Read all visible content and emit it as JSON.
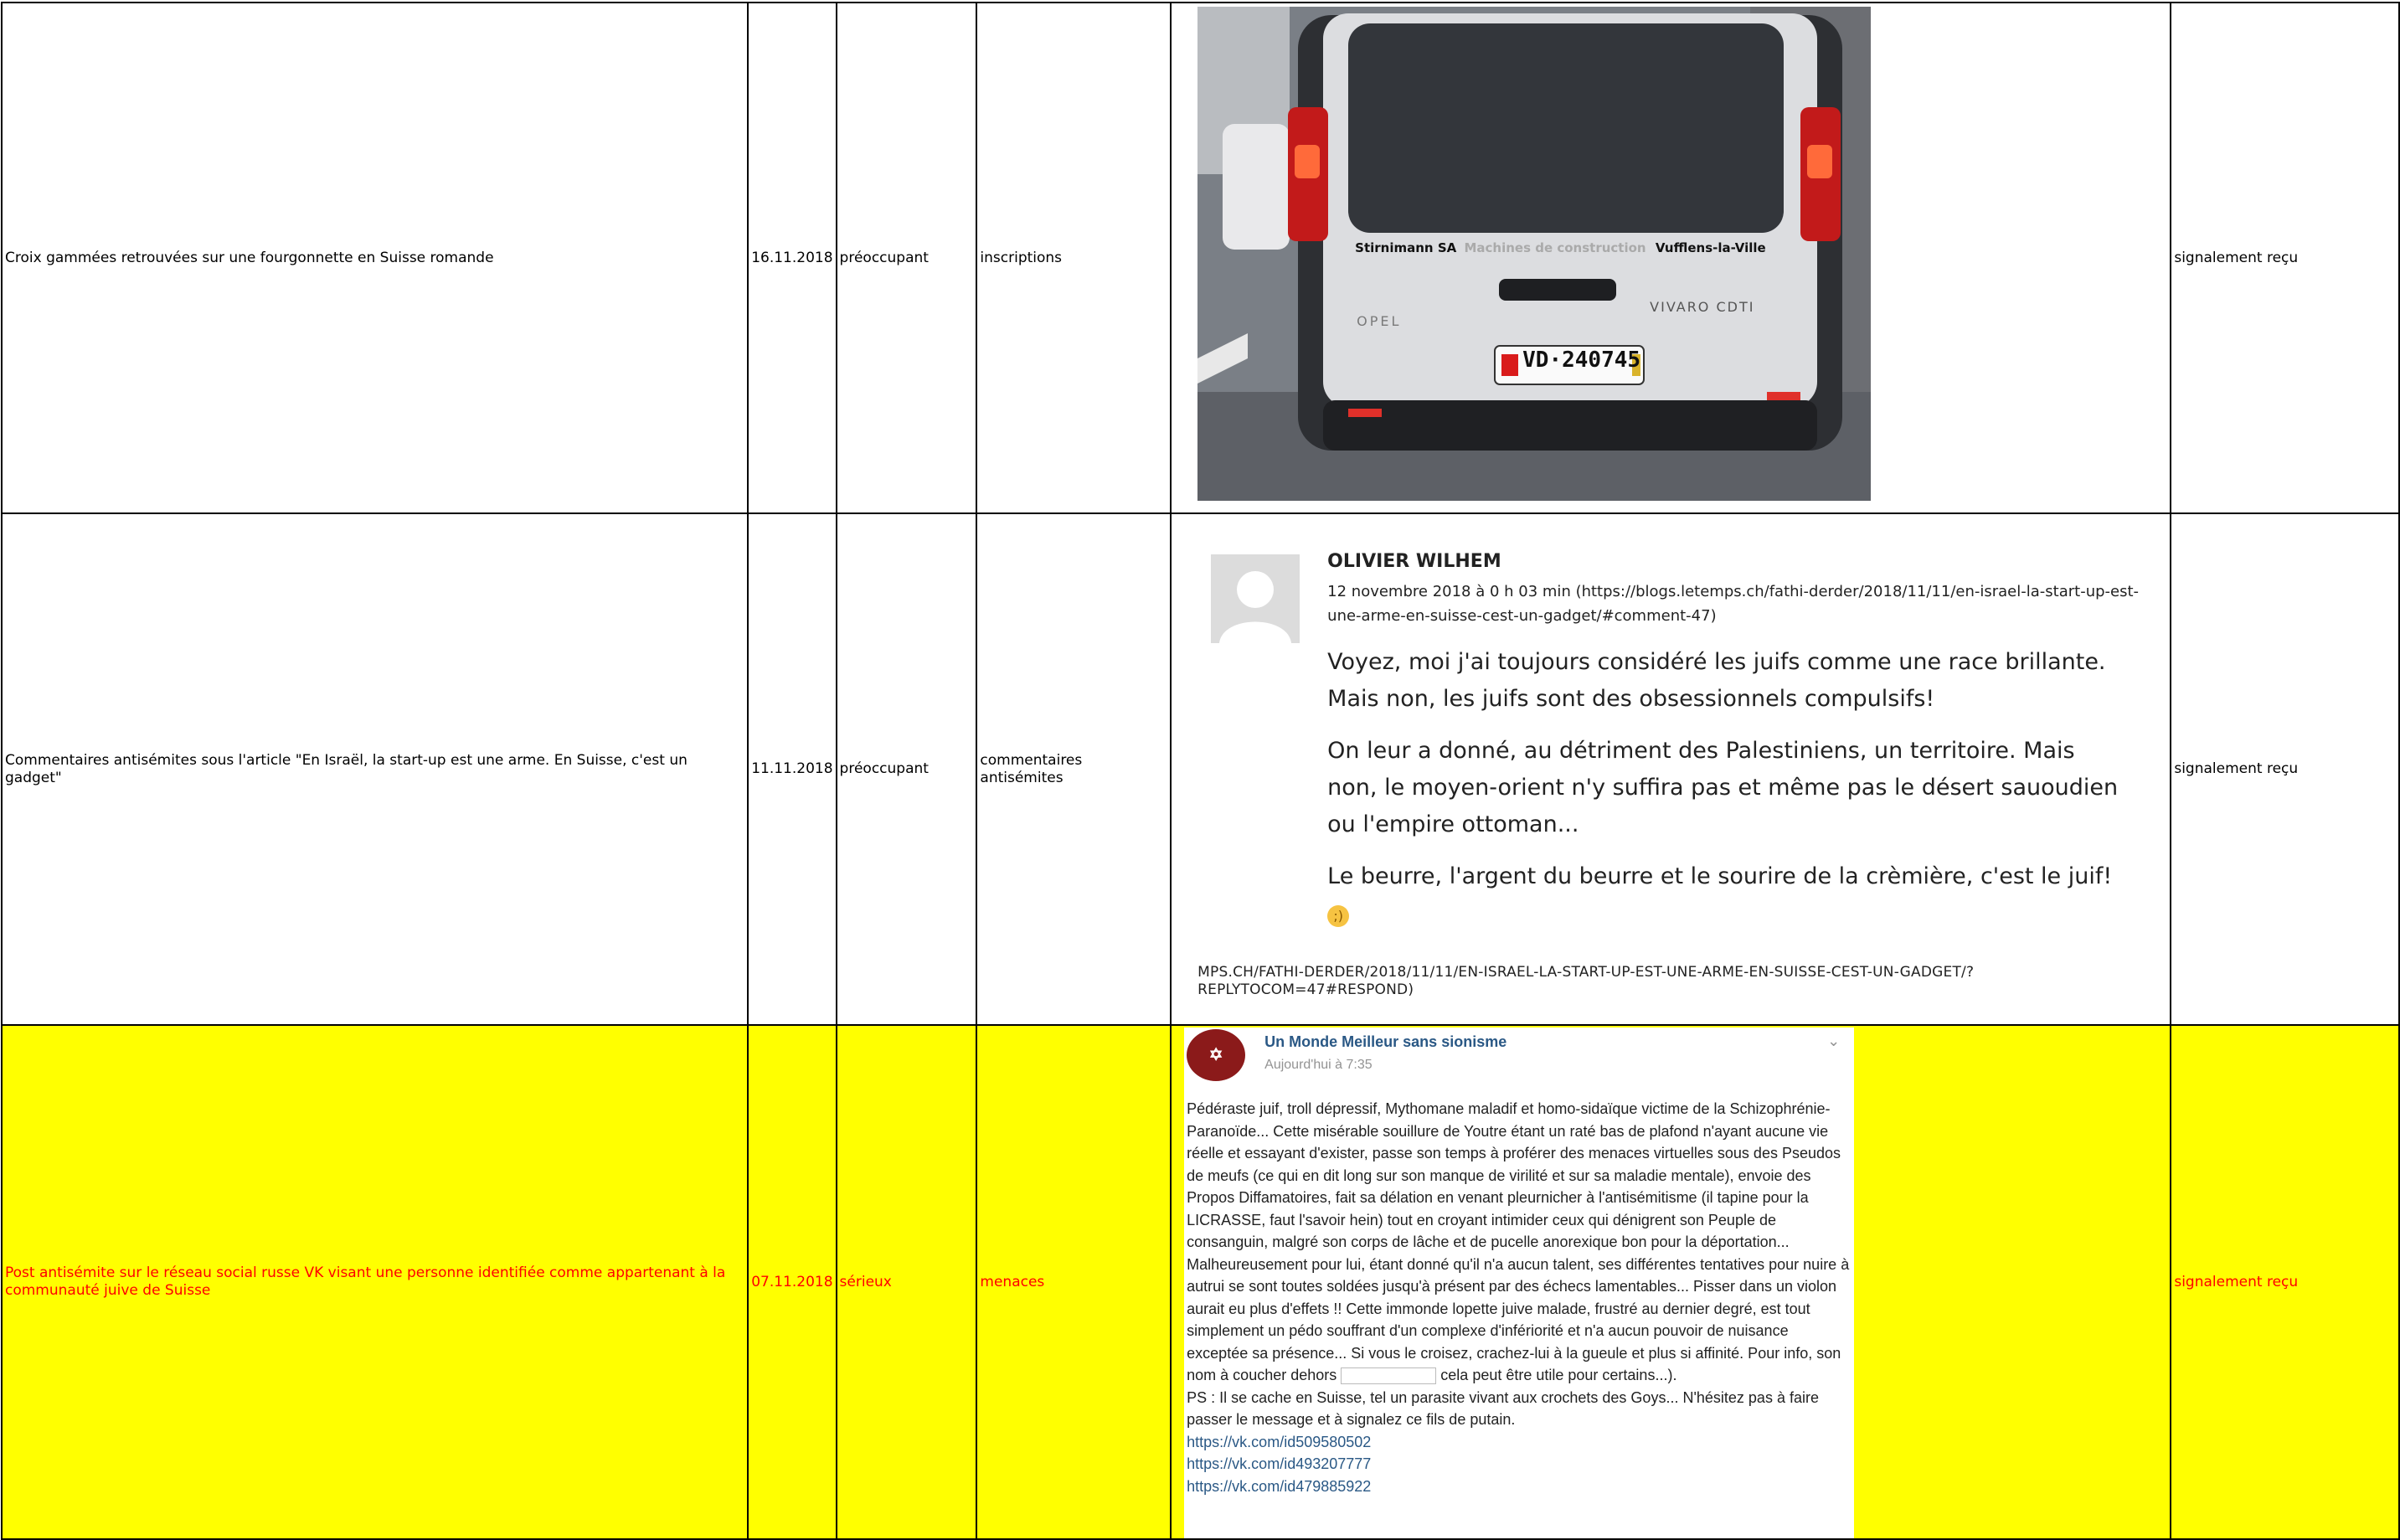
{
  "rows": [
    {
      "title": "Croix gammées retrouvées sur une fourgonnette en Suisse romande",
      "date": "16.11.2018",
      "severity": "préoccupant",
      "category": "inscriptions",
      "status": "signalement reçu",
      "image": {
        "company": "Stirnimann SA",
        "company_tail": "Machines de construction",
        "location": "Vufflens-la-Ville",
        "brand": "OPEL",
        "model": "VIVARO CDTI",
        "plate": "VD·240745"
      }
    },
    {
      "title": "Commentaires antisémites sous l'article \"En Israël, la start-up est une arme. En Suisse, c'est un gadget\"",
      "date": "11.11.2018",
      "severity": "préoccupant",
      "category": "commentaires antisémites",
      "status": "signalement reçu",
      "image": {
        "author": "OLIVIER WILHEM",
        "meta": "12 novembre 2018 à 0 h 03 min (https://blogs.letemps.ch/fathi-derder/2018/11/11/en-israel-la-start-up-est-une-arme-en-suisse-cest-un-gadget/#comment-47)",
        "p1": "Voyez, moi j'ai toujours considéré les juifs comme une race brillante.",
        "p1b": "Mais non, les juifs sont des obsessionnels compulsifs!",
        "p2": "On leur a donné, au détriment des Palestiniens, un territoire. Mais non, le moyen-orient n'y suffira pas et même pas le désert sauoudien ou l'empire ottoman...",
        "p3": "Le beurre, l'argent du beurre et le sourire de la crèmière, c'est le juif!",
        "reply_url": "MPS.CH/FATHI-DERDER/2018/11/11/EN-ISRAEL-LA-START-UP-EST-UNE-ARME-EN-SUISSE-CEST-UN-GADGET/?REPLYTOCOM=47#RESPOND)"
      }
    },
    {
      "title": "Post antisémite sur le réseau social russe VK visant une personne identifiée comme appartenant à la communauté juive de Suisse",
      "date": "07.11.2018",
      "severity": "sérieux",
      "category": "menaces",
      "status": "signalement reçu",
      "image": {
        "group": "Un Monde Meilleur sans sionisme",
        "time": "Aujourd'hui à 7:35",
        "text_a": "Pédéraste juif, troll dépressif, Mythomane maladif et homo-sidaïque victime de la Schizophrénie-Paranoïde... Cette misérable souillure de Youtre étant un raté bas de plafond n'ayant aucune vie réelle et essayant d'exister, passe son temps à proférer des menaces virtuelles sous des Pseudos de meufs (ce qui en dit long sur son manque de virilité et sur sa maladie mentale), envoie des Propos Diffamatoires, fait sa délation en venant pleurnicher à l'antisémitisme (il tapine pour la LICRASSE, faut l'savoir hein) tout en croyant intimider ceux qui dénigrent son Peuple de consanguin, malgré son corps de lâche et de pucelle anorexique bon pour la déportation... Malheureusement pour lui, étant donné qu'il n'a aucun talent, ses différentes tentatives pour nuire à autrui se sont toutes soldées jusqu'à présent par des échecs lamentables... Pisser dans un violon aurait eu plus d'effets !! Cette immonde lopette juive malade, frustré au dernier degré, est tout simplement un pédo souffrant d'un complexe d'infériorité et n'a aucun pouvoir de nuisance exceptée sa présence... Si vous le croisez, crachez-lui à la gueule et plus si affinité. Pour info, son nom à coucher dehors",
        "text_b": "cela peut être utile pour certains...).",
        "text_c": "PS : Il se cache en Suisse, tel un parasite vivant aux crochets des Goys... N'hésitez pas à faire passer le message et à signalez ce fils de putain.",
        "links": [
          "https://vk.com/id509580502",
          "https://vk.com/id493207777",
          "https://vk.com/id479885922"
        ]
      }
    }
  ],
  "colors": {
    "highlight_bg": "#ffff00",
    "highlight_text": "#ff0000",
    "vk_link": "#2a5885"
  }
}
